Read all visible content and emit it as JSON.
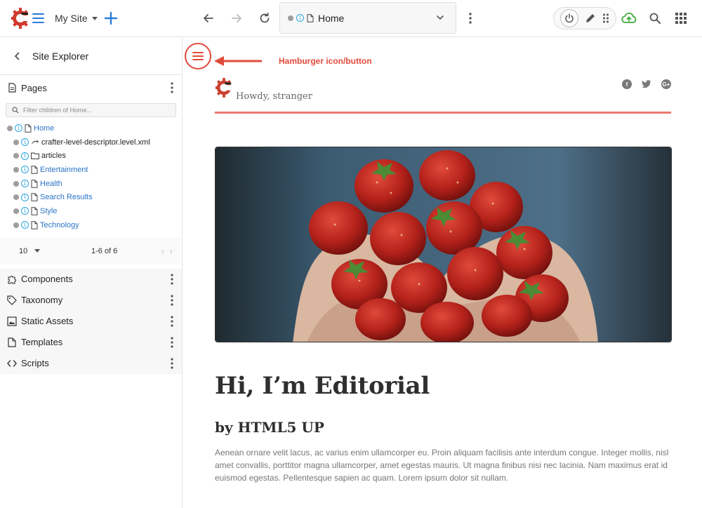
{
  "topbar": {
    "site_name": "My Site",
    "address": {
      "url_label": "Home"
    },
    "accent": "#2b7bd8"
  },
  "sidebar": {
    "header_title": "Site Explorer",
    "pages": {
      "label": "Pages",
      "filter_placeholder": "Filter children of Home...",
      "tree": {
        "root": {
          "label": "Home"
        },
        "children": [
          {
            "label": "crafter-level-descriptor.level.xml",
            "icon": "level-descriptor-icon"
          },
          {
            "label": "articles",
            "icon": "folder-icon"
          },
          {
            "label": "Entertainment",
            "icon": "page-icon"
          },
          {
            "label": "Health",
            "icon": "page-icon"
          },
          {
            "label": "Search Results",
            "icon": "page-icon"
          },
          {
            "label": "Style",
            "icon": "page-icon"
          },
          {
            "label": "Technology",
            "icon": "page-icon"
          }
        ]
      },
      "pager": {
        "page_size": "10",
        "range": "1-6 of 6"
      }
    },
    "sections": [
      {
        "label": "Components",
        "icon": "puzzle-icon"
      },
      {
        "label": "Taxonomy",
        "icon": "tag-icon"
      },
      {
        "label": "Static Assets",
        "icon": "image-icon"
      },
      {
        "label": "Templates",
        "icon": "document-icon"
      },
      {
        "label": "Scripts",
        "icon": "code-icon"
      }
    ]
  },
  "preview": {
    "annotation": "Hamburger icon/button",
    "annotation_color": "#e14b3b",
    "greeting": "Howdy, stranger",
    "heading": "Hi, I’m Editorial",
    "subheading": "by HTML5 UP",
    "paragraph": "Aenean ornare velit lacus, ac varius enim ullamcorper eu. Proin aliquam facilisis ante interdum congue. Integer mollis, nisl amet convallis, porttitor magna ullamcorper, amet egestas mauris. Ut magna finibus nisi nec lacinia. Nam maximus erat id euismod egestas. Pellentesque sapien ac quam. Lorem ipsum dolor sit nullam."
  }
}
